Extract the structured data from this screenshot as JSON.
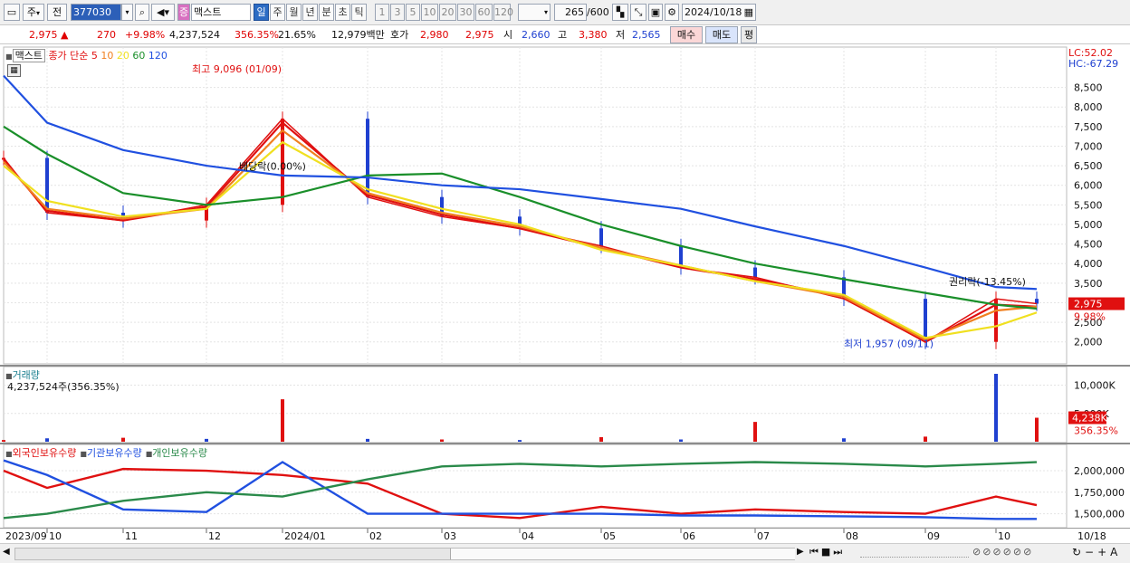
{
  "toolbar": {
    "market": "주",
    "scope": "전",
    "code": "377030",
    "type_badge": "증",
    "name": "맥스트",
    "periods": [
      "일",
      "주",
      "월",
      "년",
      "분",
      "초",
      "틱"
    ],
    "active_period": "일",
    "intervals": [
      "1",
      "3",
      "5",
      "10",
      "20",
      "30",
      "60",
      "120"
    ],
    "count": "265",
    "count_max": "/600",
    "date": "2024/10/18"
  },
  "quote": {
    "price": "2,975",
    "change": "270",
    "change_pct": "+9.98%",
    "volume": "4,237,524",
    "volume_ratio": "356.35%",
    "turnover": "21.65%",
    "amount": "12,979백만",
    "bid_label": "호가",
    "ask": "2,980",
    "bid": "2,975",
    "open_label": "시",
    "open": "2,660",
    "high_label": "고",
    "high": "3,380",
    "low_label": "저",
    "low": "2,565",
    "buy": "매수",
    "sell": "매도",
    "avg": "평"
  },
  "price_panel": {
    "legend_name": "맥스트",
    "legend_ma_label": "종가 단순",
    "ma_periods": [
      "5",
      "10",
      "20",
      "60",
      "120"
    ],
    "ma_colors": [
      "#e01010",
      "#f08020",
      "#f0e020",
      "#1a8f2a",
      "#2050e0"
    ],
    "lc": "LC:52.02",
    "hc": "HC:-67.29",
    "high_annotation": "최고 9,096 (01/09)",
    "low_annotation": "최저 1,957 (09/11)",
    "dividend_annotation": "배당락(0.00%)",
    "rights_annotation": "권리락(-13.45%)",
    "current_price_tag": "2,975",
    "current_pct_tag": "9.98%"
  },
  "volume_panel": {
    "title": "거래량",
    "value": "4,237,524주(356.35%)",
    "current_tag": "4,238K",
    "current_pct": "356.35%"
  },
  "holdings_panel": {
    "legend": [
      "외국인보유수량",
      "기관보유수량",
      "개인보유수량"
    ],
    "colors": [
      "#e01010",
      "#2050e0",
      "#2a8a4a"
    ]
  },
  "x_axis": {
    "labels": [
      "2023/09",
      "10",
      "11",
      "12",
      "2024/01",
      "02",
      "03",
      "04",
      "05",
      "06",
      "07",
      "08",
      "09",
      "10",
      "10/18"
    ]
  },
  "chart_data": [
    {
      "type": "line",
      "title": "",
      "y_axis_ticks": [
        2000,
        2500,
        3000,
        3500,
        4000,
        4500,
        5000,
        5500,
        6000,
        6500,
        7000,
        7500,
        8000,
        8500
      ],
      "y_axis_labels": [
        "2,000",
        "2,500",
        "3,000",
        "3,500",
        "4,000",
        "4,500",
        "5,000",
        "5,500",
        "6,000",
        "6,500",
        "7,000",
        "7,500",
        "8,000",
        "8,500"
      ],
      "ylim": [
        1600,
        9300
      ],
      "x": [
        "2023/09",
        "10",
        "11",
        "12",
        "2024/01",
        "02",
        "03",
        "04",
        "05",
        "06",
        "07",
        "08",
        "09",
        "10",
        "10/18"
      ],
      "series": [
        {
          "name": "종가",
          "values": [
            6700,
            5300,
            5100,
            5500,
            7700,
            5700,
            5200,
            4900,
            4450,
            3900,
            3650,
            3100,
            2000,
            3100,
            2975
          ]
        },
        {
          "name": "5",
          "values": [
            6650,
            5350,
            5100,
            5450,
            7600,
            5750,
            5250,
            4900,
            4400,
            3900,
            3600,
            3150,
            2000,
            2950,
            2900
          ]
        },
        {
          "name": "10",
          "values": [
            6600,
            5400,
            5150,
            5400,
            7400,
            5800,
            5300,
            4950,
            4400,
            3950,
            3550,
            3150,
            2050,
            2800,
            2900
          ]
        },
        {
          "name": "20",
          "values": [
            6500,
            5600,
            5200,
            5400,
            7100,
            5900,
            5400,
            5000,
            4350,
            3950,
            3550,
            3200,
            2100,
            2400,
            2750
          ]
        },
        {
          "name": "60",
          "values": [
            7500,
            6800,
            5800,
            5500,
            5700,
            6250,
            6300,
            5700,
            5000,
            4450,
            4000,
            3600,
            3250,
            2950,
            2850
          ]
        },
        {
          "name": "120",
          "values": [
            8800,
            7600,
            6900,
            6500,
            6250,
            6200,
            6000,
            5900,
            5650,
            5400,
            4950,
            4450,
            3900,
            3400,
            3350
          ]
        }
      ],
      "extremes": {
        "high": 9096,
        "high_date": "01/09",
        "low": 1957,
        "low_date": "09/11"
      }
    },
    {
      "type": "bar",
      "title": "거래량",
      "y_axis_labels": [
        "10,000K",
        "5,000K"
      ],
      "ylim": [
        0,
        12000
      ],
      "x": [
        "2023/09",
        "10",
        "11",
        "12",
        "2024/01",
        "02",
        "03",
        "04",
        "05",
        "06",
        "07",
        "08",
        "09",
        "10",
        "10/18"
      ],
      "values_k": [
        300,
        600,
        700,
        500,
        7500,
        500,
        400,
        300,
        800,
        400,
        3500,
        600,
        900,
        12000,
        4238
      ]
    },
    {
      "type": "line",
      "title": "",
      "y_axis_labels": [
        "2,000,000",
        "1,750,000",
        "1,500,000"
      ],
      "x": [
        "2023/09",
        "10",
        "11",
        "12",
        "2024/01",
        "02",
        "03",
        "04",
        "05",
        "06",
        "07",
        "08",
        "09",
        "10",
        "10/18"
      ],
      "series": [
        {
          "name": "외국인보유수량",
          "values": [
            2000000,
            1800000,
            2020000,
            2000000,
            1950000,
            1850000,
            1500000,
            1450000,
            1580000,
            1500000,
            1550000,
            1520000,
            1500000,
            1700000,
            1600000
          ]
        },
        {
          "name": "기관보유수량",
          "values": [
            2120000,
            1950000,
            1550000,
            1520000,
            2100000,
            1500000,
            1500000,
            1500000,
            1500000,
            1480000,
            1480000,
            1470000,
            1460000,
            1440000,
            1440000
          ]
        },
        {
          "name": "개인보유수량",
          "values": [
            1450000,
            1500000,
            1650000,
            1750000,
            1700000,
            1900000,
            2050000,
            2080000,
            2050000,
            2080000,
            2100000,
            2080000,
            2050000,
            2080000,
            2100000
          ]
        }
      ]
    }
  ]
}
